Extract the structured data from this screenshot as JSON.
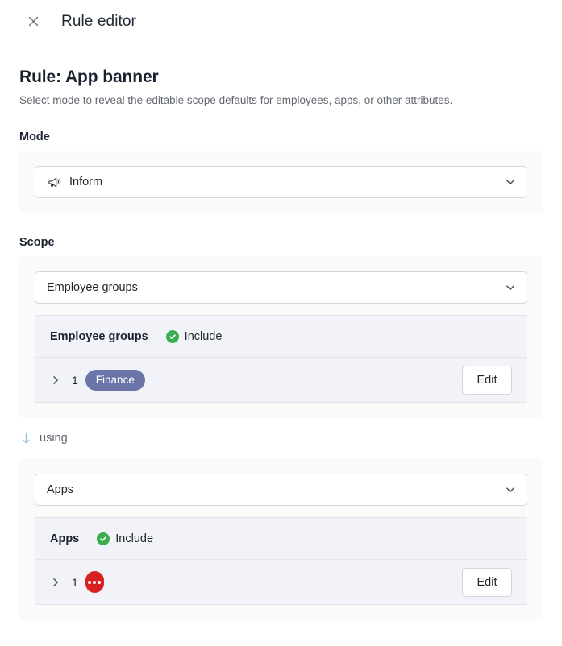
{
  "header": {
    "close_icon": "close-icon",
    "title": "Rule editor"
  },
  "rule": {
    "title": "Rule: App banner",
    "subtitle": "Select mode to reveal the editable scope defaults for employees, apps, or other attributes."
  },
  "mode": {
    "section_label": "Mode",
    "select": {
      "icon": "megaphone-icon",
      "value": "Inform",
      "chevron_icon": "chevron-down-icon"
    }
  },
  "scope": {
    "section_label": "Scope",
    "blocks": [
      {
        "select": {
          "value": "Employee groups",
          "chevron_icon": "chevron-down-icon"
        },
        "panel": {
          "title": "Employee groups",
          "badge": {
            "icon": "check-circle-icon",
            "label": "Include",
            "color": "#3aad4f"
          },
          "row": {
            "expand_icon": "chevron-right-icon",
            "count": "1",
            "chip": {
              "type": "text",
              "label": "Finance",
              "color": "#6b75a8"
            },
            "edit_label": "Edit"
          }
        }
      },
      {
        "select": {
          "value": "Apps",
          "chevron_icon": "chevron-down-icon"
        },
        "panel": {
          "title": "Apps",
          "badge": {
            "icon": "check-circle-icon",
            "label": "Include",
            "color": "#3aad4f"
          },
          "row": {
            "expand_icon": "chevron-right-icon",
            "count": "1",
            "chip": {
              "type": "dots",
              "label": "",
              "color": "#d92020"
            },
            "edit_label": "Edit"
          }
        }
      }
    ]
  },
  "connector": {
    "arrow_icon": "arrow-down-icon",
    "label": "using",
    "color": "#8fc3d6"
  }
}
